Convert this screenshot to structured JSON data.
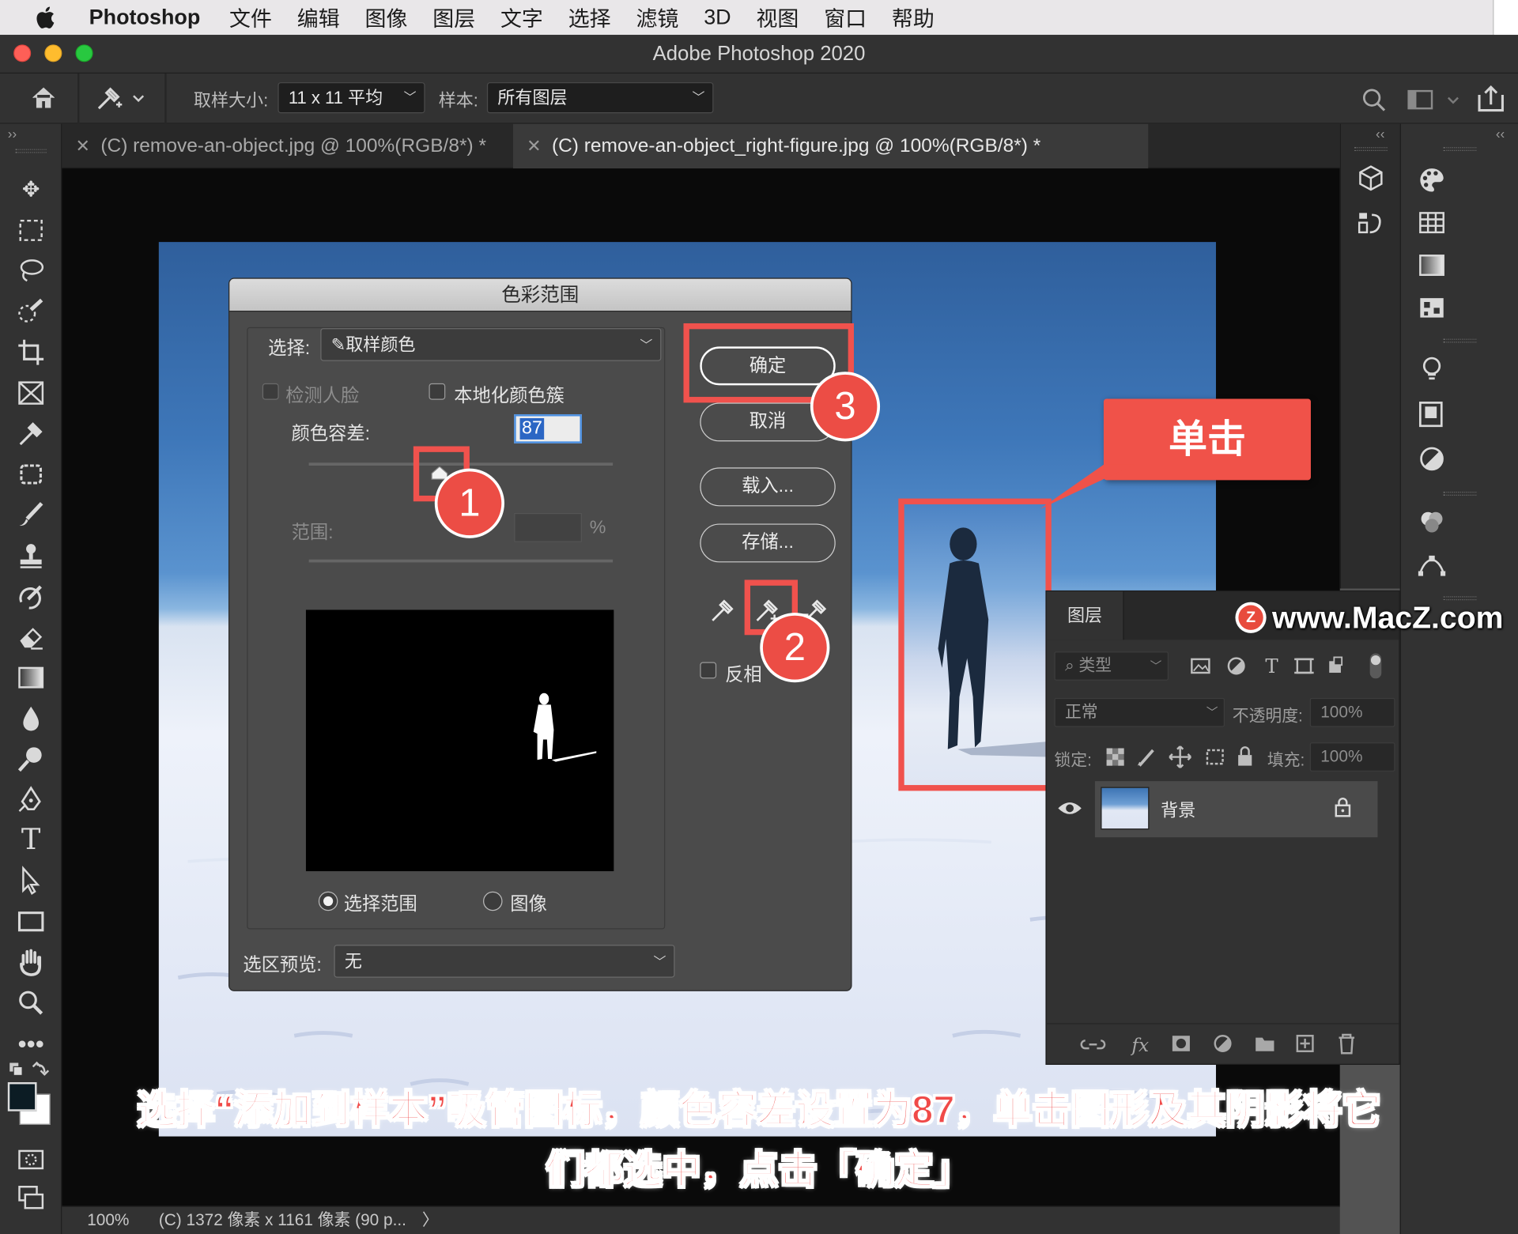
{
  "menubar": {
    "app_name": "Photoshop",
    "items": [
      "文件",
      "编辑",
      "图像",
      "图层",
      "文字",
      "选择",
      "滤镜",
      "3D",
      "视图",
      "窗口",
      "帮助"
    ]
  },
  "window": {
    "title": "Adobe Photoshop 2020"
  },
  "options_bar": {
    "sample_size_label": "取样大小:",
    "sample_size_value": "11 x 11 平均",
    "sample_label": "样本:",
    "sample_value": "所有图层"
  },
  "tabs": [
    {
      "label": "(C) remove-an-object.jpg @ 100%(RGB/8*) *",
      "active": false
    },
    {
      "label": "(C) remove-an-object_right-figure.jpg @ 100%(RGB/8*) *",
      "active": true
    }
  ],
  "status_bar": {
    "zoom": "100%",
    "doc_info": "(C) 1372 像素 x 1161 像素 (90 p...",
    "arrow": "〉"
  },
  "dialog": {
    "title": "色彩范围",
    "select_label": "选择:",
    "select_value": "取样颜色",
    "detect_faces_label": "检测人脸",
    "localized_label": "本地化颜色簇",
    "fuzziness_label": "颜色容差:",
    "fuzziness_value": "87",
    "fuzziness_fraction": 0.43,
    "range_label": "范围:",
    "range_unit": "%",
    "ok_label": "确定",
    "cancel_label": "取消",
    "load_label": "载入...",
    "save_label": "存储...",
    "invert_label": "反相",
    "radio_selection_label": "选择范围",
    "radio_image_label": "图像",
    "selection_preview_label": "选区预览:",
    "selection_preview_value": "无"
  },
  "layers_panel": {
    "tab_label": "图层",
    "filter_label": "类型",
    "blend_mode": "正常",
    "opacity_label": "不透明度:",
    "opacity_value": "100%",
    "lock_label": "锁定:",
    "fill_label": "填充:",
    "fill_value": "100%",
    "layer_name": "背景"
  },
  "annotations": {
    "step1": "1",
    "step2": "2",
    "step3": "3",
    "click_callout": "单击",
    "watermark": "www.MacZ.com",
    "caption_line1": "选择“添加到样本”吸管图标，颜色容差设置为87，单击图形及其阴影将它",
    "caption_line2": "们都选中，点击「确定」"
  },
  "colors": {
    "annotation_red": "#f0524d",
    "dialog_bg": "#4b4b4b",
    "ui_dark": "#323232"
  }
}
